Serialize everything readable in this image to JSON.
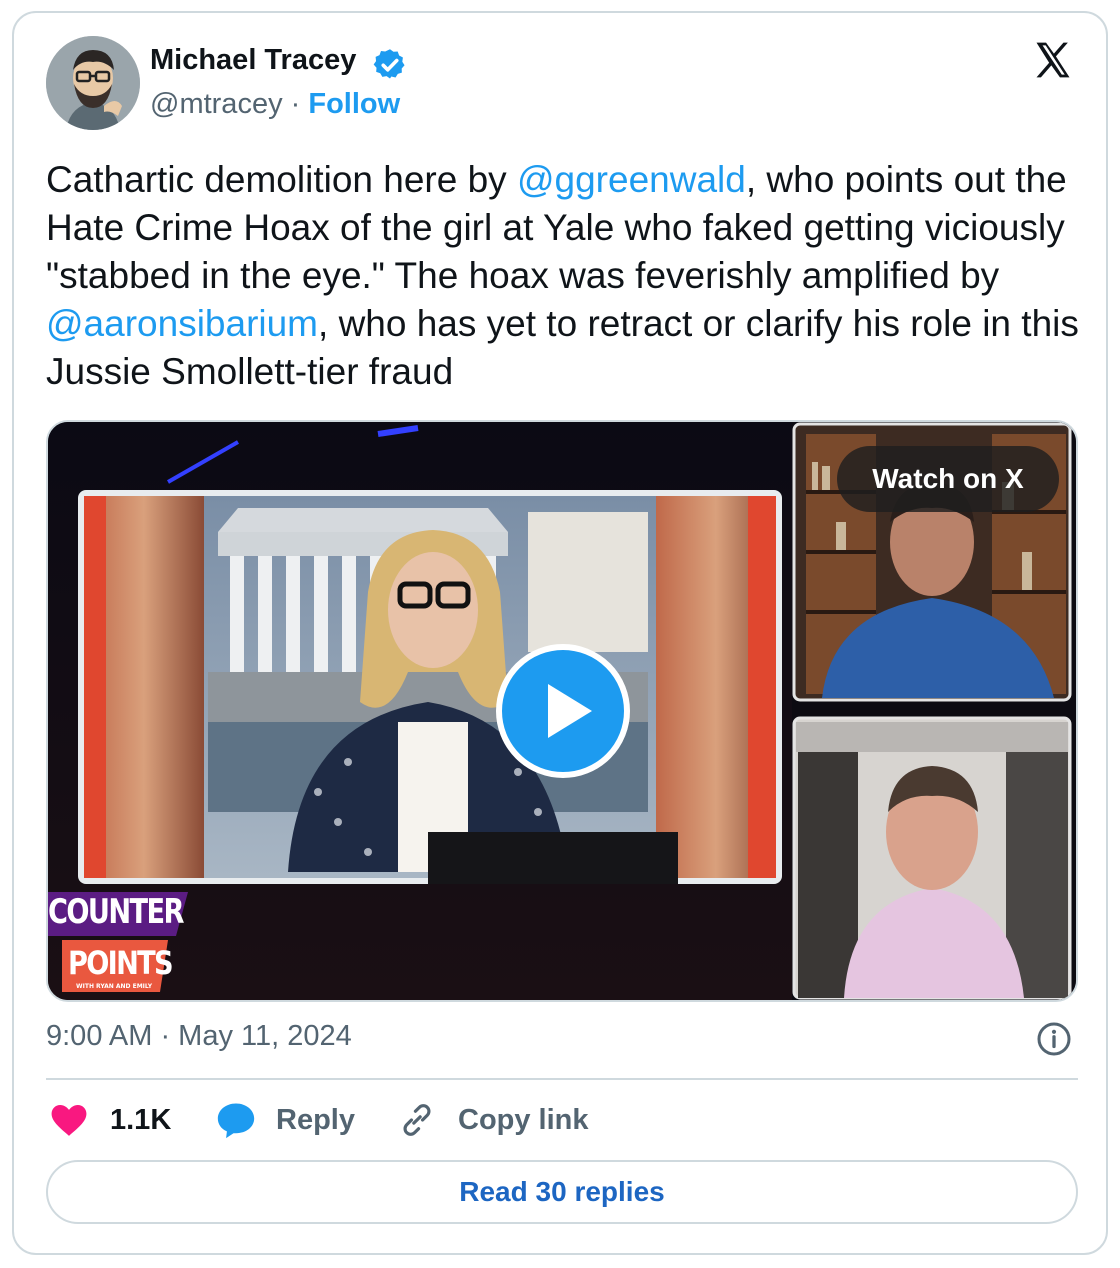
{
  "author": {
    "name": "Michael Tracey",
    "handle": "@mtracey",
    "separator": " · ",
    "follow_label": "Follow"
  },
  "tweet": {
    "segments": [
      {
        "text": "Cathartic demolition here by ",
        "mention": false
      },
      {
        "text": "@ggreenwald",
        "mention": true
      },
      {
        "text": ", who points out the Hate Crime Hoax of the girl at Yale who faked getting viciously \"stabbed in the eye.\" The hoax was feverishly amplified by ",
        "mention": false
      },
      {
        "text": "@aaronsibarium",
        "mention": true
      },
      {
        "text": ", who has yet to retract or clarify his role in this Jussie Smollett-tier fraud",
        "mention": false
      }
    ]
  },
  "media": {
    "watch_label": "Watch on X",
    "show_logo_line1": "COUNTER",
    "show_logo_line2": "POINTS",
    "show_logo_sub": "WITH RYAN AND EMILY"
  },
  "timestamp": "9:00 AM · May 11, 2024",
  "actions": {
    "likes": "1.1K",
    "reply_label": "Reply",
    "copy_label": "Copy link"
  },
  "read_replies_label": "Read 30 replies",
  "colors": {
    "accent": "#1d9bf0",
    "like": "#f91880",
    "text": "#0f1419",
    "muted": "#536471",
    "border": "#cfd9de"
  }
}
